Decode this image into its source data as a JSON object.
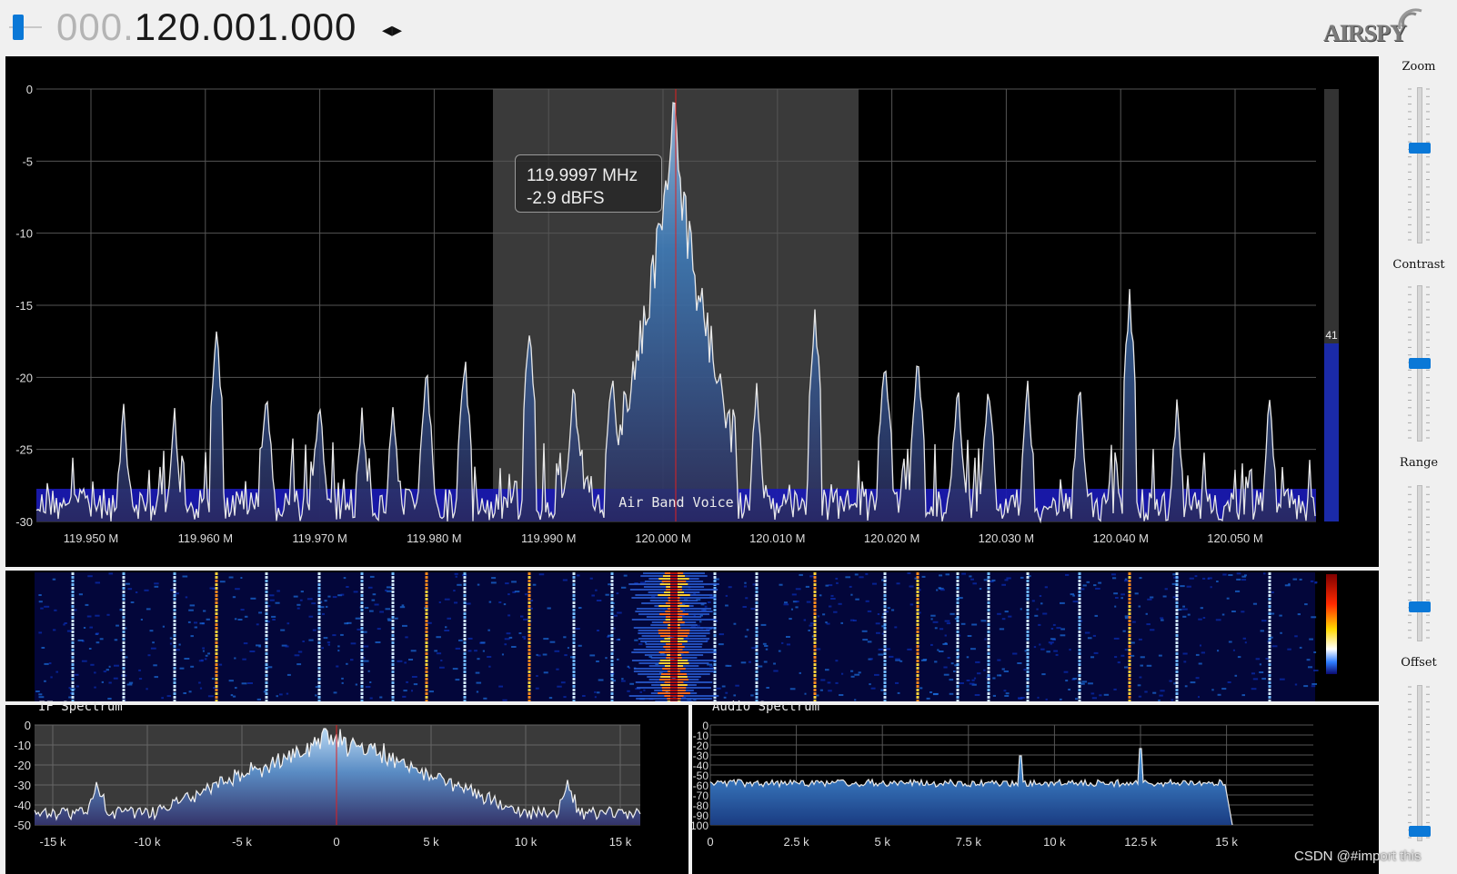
{
  "header": {
    "frequency_dim": "000.",
    "frequency_main": "120.001.000",
    "arrows_glyph": "◂▸",
    "logo_text": "AIRSPY"
  },
  "colors": {
    "accent": "#0a78d7",
    "band": "#1a1ab4",
    "marker": "#e02020",
    "trace": "#e8e8e8"
  },
  "spectrum": {
    "y_ticks": [
      "0",
      "-5",
      "-10",
      "-15",
      "-20",
      "-25",
      "-30"
    ],
    "x_ticks": [
      "119.950 M",
      "119.960 M",
      "119.970 M",
      "119.980 M",
      "119.990 M",
      "120.000 M",
      "120.010 M",
      "120.020 M",
      "120.030 M",
      "120.040 M",
      "120.050 M"
    ],
    "tooltip_freq": "119.9997 MHz",
    "tooltip_level": "-2.9 dBFS",
    "band_label": "Air Band Voice",
    "level_value": "41"
  },
  "if_spectrum": {
    "title": "IF Spectrum",
    "y_ticks": [
      "0",
      "-10",
      "-20",
      "-30",
      "-40",
      "-50"
    ],
    "x_ticks": [
      "-15 k",
      "-10 k",
      "-5 k",
      "0",
      "5 k",
      "10 k",
      "15 k"
    ]
  },
  "audio_spectrum": {
    "title": "Audio Spectrum",
    "y_ticks": [
      "0",
      "-10",
      "-20",
      "-30",
      "-40",
      "-50",
      "-60",
      "-70",
      "-80",
      "-90",
      "-100"
    ],
    "x_ticks": [
      "0",
      "2.5 k",
      "5 k",
      "7.5 k",
      "10 k",
      "12.5 k",
      "15 k"
    ]
  },
  "sliders": [
    {
      "label": "Zoom",
      "level": 0.38
    },
    {
      "label": "Contrast",
      "level": 0.5
    },
    {
      "label": "Range",
      "level": 0.8
    },
    {
      "label": "Offset",
      "level": 0.97
    }
  ],
  "watermark": "CSDN @#import this"
}
